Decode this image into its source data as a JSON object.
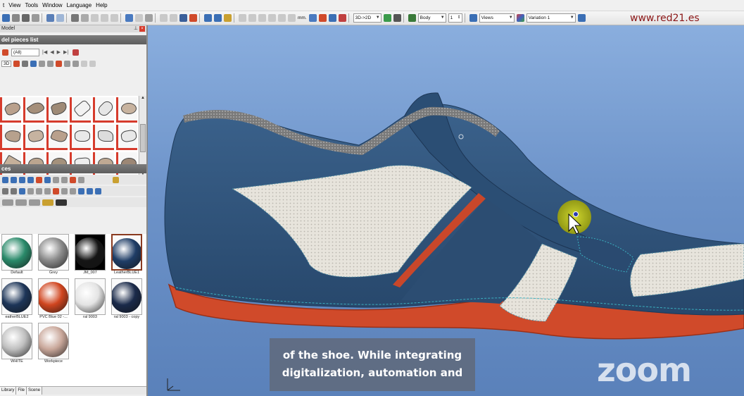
{
  "menu": {
    "items": [
      "t",
      "View",
      "Tools",
      "Window",
      "Language",
      "Help"
    ]
  },
  "toolbar": {
    "unit_label": "mm.",
    "mode_combo": "3D->2D",
    "body_combo": "Body",
    "body_count": "1",
    "views_label": "Views",
    "variation_combo": "Variation 1"
  },
  "site_url": "www.red21.es",
  "left_panel": {
    "model_title": "Model",
    "pieces_list_header": "del pieces list",
    "filter_combo": "(All)",
    "view_mode": "3D",
    "pieces_header": "ces",
    "materials": [
      {
        "label": "Default",
        "color": "#2a8a6a"
      },
      {
        "label": "Grey",
        "color": "#8a8a8a"
      },
      {
        "label": "JM_007",
        "color": "#151515"
      },
      {
        "label": "LeatherBLUE1",
        "color": "#1f3d66"
      },
      {
        "label": "eatherBLUE2",
        "color": "#1d3558"
      },
      {
        "label": "PVC Blue 02 -...",
        "color": "#d0451f"
      },
      {
        "label": "ral 9003",
        "color": "#e4e4e4"
      },
      {
        "label": "ral 9003 - copy",
        "color": "#1a2a4a"
      },
      {
        "label": "WHITE",
        "color": "#bfbfbf"
      },
      {
        "label": "Workpiece",
        "color": "#c9a79a"
      }
    ],
    "bottom_tabs": [
      "Library",
      "File",
      "Scene"
    ]
  },
  "subtitle": {
    "line1": "of the shoe. While integrating",
    "line2": "digitalization, automation and"
  },
  "watermark": "zoom",
  "colors": {
    "shoe_blue": "#2f5378",
    "sole_red": "#d04a2a",
    "mesh_white": "#e8e6df",
    "accent_red": "#c9472a",
    "cursor_highlight": "#c8cc10"
  }
}
